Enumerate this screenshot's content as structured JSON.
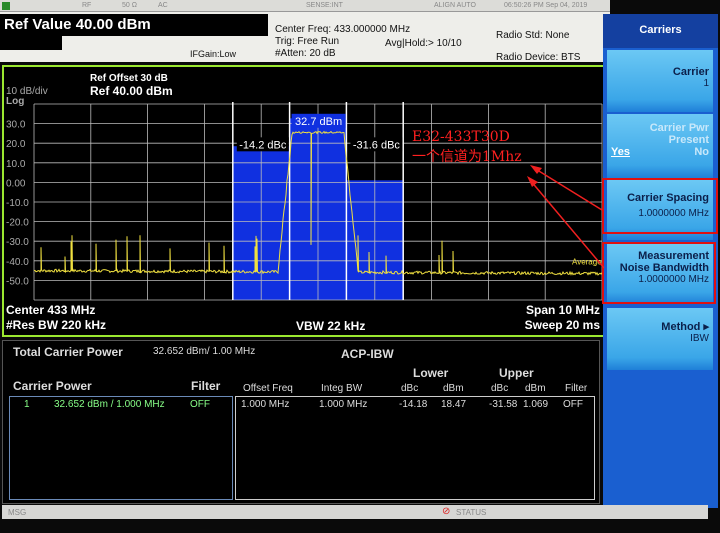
{
  "status_bar": {
    "rf": "RF",
    "impedance": "50 Ω",
    "coupling": "AC",
    "sense": "SENSE:INT",
    "align": "ALIGN AUTO",
    "datetime": "06:50:26 PM Sep 04, 2019"
  },
  "header": {
    "ref_value": "Ref Value 40.00 dBm",
    "center_freq": "Center Freq: 433.000000 MHz",
    "trig": "Trig: Free Run",
    "atten": "#Atten: 20 dB",
    "avg_hold": "Avg|Hold:> 10/10",
    "ifgain": "IFGain:Low",
    "radio_std": "Radio Std: None",
    "radio_device": "Radio Device: BTS"
  },
  "plot": {
    "ref_offset": "Ref Offset 30 dB",
    "ref_level": "Ref 40.00 dBm",
    "scale": "10 dB/div",
    "scale_type": "Log",
    "y_ticks": [
      "30.0",
      "20.0",
      "10.0",
      "0.00",
      "-10.0",
      "-20.0",
      "-30.0",
      "-40.0",
      "-50.0"
    ],
    "lower_label": "-14.2 dBc",
    "carrier_label": "32.7 dBm",
    "upper_label": "-31.6 dBc",
    "average_label": "Average",
    "center": "Center 433 MHz",
    "res_bw": "#Res BW 220 kHz",
    "vbw": "VBW 22 kHz",
    "span": "Span 10 MHz",
    "sweep": "Sweep 20 ms",
    "ref_dbm": 40,
    "div_db": 10,
    "center_mhz": 433,
    "span_mhz": 10,
    "bands": {
      "lower_dbm": 18.47,
      "carrier_dbm": 32.7,
      "upper_dbm": 1.069,
      "bw_mhz": 1.0
    },
    "trace_color": "#f0e040",
    "band_color": "#1030e0"
  },
  "annotation": {
    "line1": "E32-433T30D",
    "line2": "一个信道为1Mhz",
    "color": "#ff2020"
  },
  "results": {
    "total_label": "Total Carrier Power",
    "total_value": "32.652 dBm/ 1.00 MHz",
    "mode": "ACP-IBW",
    "carrier_power_label": "Carrier Power",
    "filter_label": "Filter",
    "carrier_row": {
      "index": "1",
      "value": "32.652 dBm /  1.000 MHz",
      "filter": "OFF"
    },
    "lower": "Lower",
    "upper": "Upper",
    "columns": [
      "Offset Freq",
      "Integ BW",
      "dBc",
      "dBm",
      "dBc",
      "dBm",
      "Filter"
    ],
    "rows": [
      [
        "1.000 MHz",
        "1.000 MHz",
        "-14.18",
        "18.47",
        "-31.58",
        "1.069",
        "OFF"
      ]
    ]
  },
  "softkeys": {
    "title": "Carriers",
    "carrier": {
      "label": "Carrier",
      "value": "1"
    },
    "carrier_pwr": {
      "label1": "Carrier Pwr",
      "label2": "Present",
      "yes": "Yes",
      "no": "No"
    },
    "spacing": {
      "label": "Carrier Spacing",
      "value": "1.0000000 MHz"
    },
    "noise_bw": {
      "label1": "Measurement",
      "label2": "Noise Bandwidth",
      "value": "1.0000000 MHz"
    },
    "method": {
      "label": "Method",
      "value": "IBW"
    }
  },
  "msg_bar": {
    "msg": "MSG",
    "status": "STATUS"
  }
}
